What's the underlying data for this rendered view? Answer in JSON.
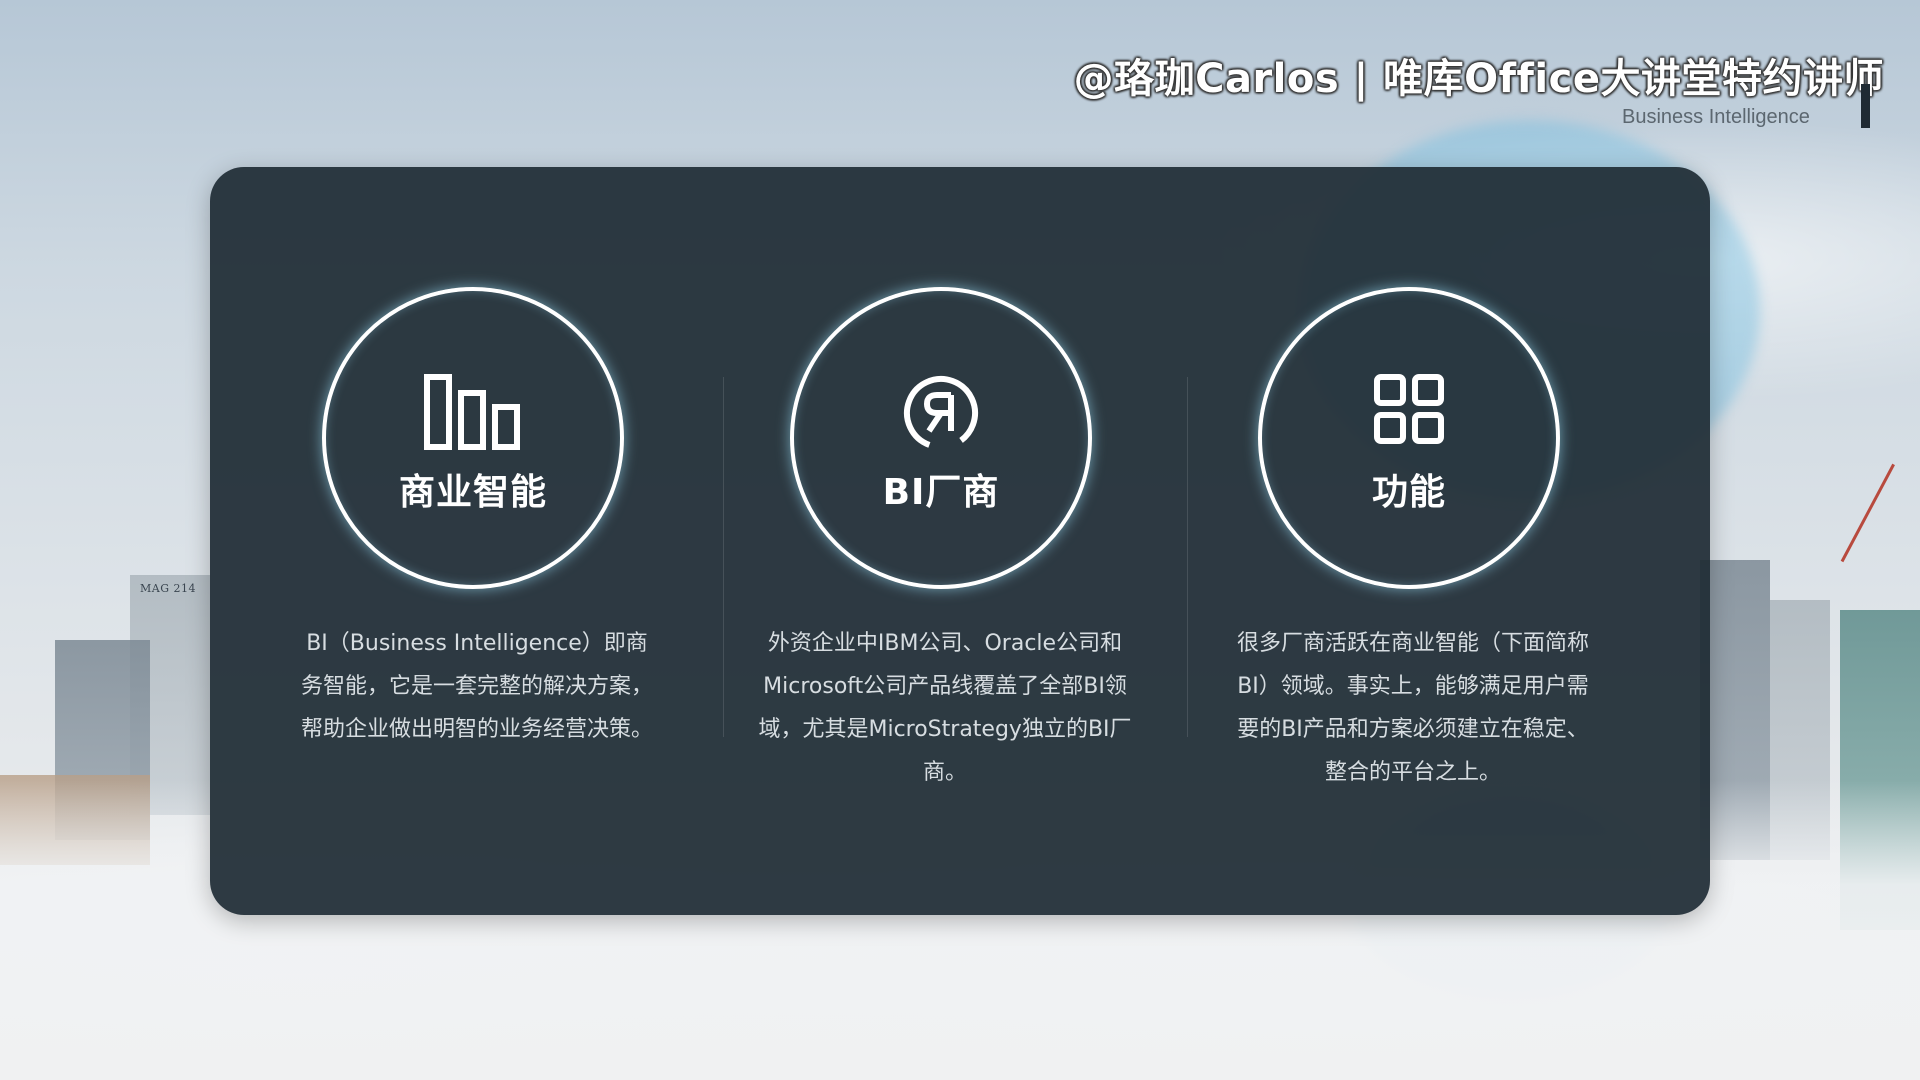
{
  "header": {
    "watermark": "@珞珈Carlos | 唯库Office大讲堂特约讲师",
    "subtitle": "Business Intelligence"
  },
  "background": {
    "building_sign": "MAG 214"
  },
  "cards": [
    {
      "icon": "bar-chart-icon",
      "title": "商业智能",
      "description": "BI（Business Intelligence）即商务智能，它是一套完整的解决方案，帮助企业做出明智的业务经营决策。"
    },
    {
      "icon": "registered-r-icon",
      "title": "BI厂商",
      "description": "外资企业中IBM公司、Oracle公司和Microsoft公司产品线覆盖了全部BI领域，尤其是MicroStrategy独立的BI厂商。"
    },
    {
      "icon": "grid-four-icon",
      "title": "功能",
      "description": "很多厂商活跃在商业智能（下面简称BI）领域。事实上，能够满足用户需要的BI产品和方案必须建立在稳定、整合的平台之上。"
    }
  ],
  "colors": {
    "panel": "#1f2c35",
    "circle_glow": "#a0e6ff",
    "text_light": "#d7dde1"
  }
}
